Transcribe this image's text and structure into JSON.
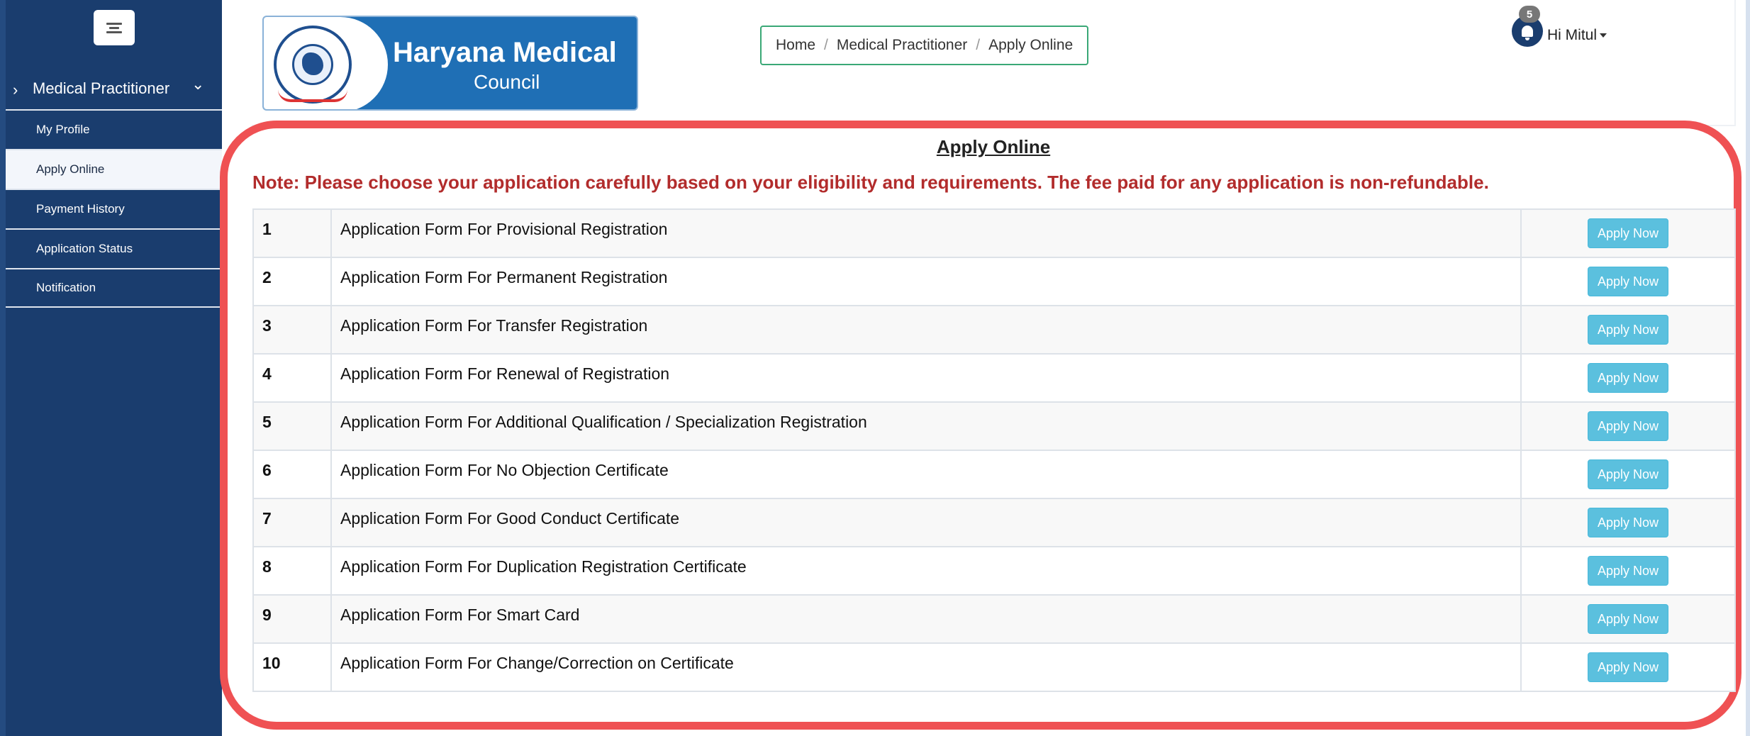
{
  "sidebar": {
    "section_label": "Medical Practitioner",
    "items": [
      {
        "label": "My Profile",
        "active": false
      },
      {
        "label": "Apply Online",
        "active": true
      },
      {
        "label": "Payment History",
        "active": false
      },
      {
        "label": "Application Status",
        "active": false
      },
      {
        "label": "Notification",
        "active": false
      }
    ]
  },
  "header": {
    "logo_title": "Haryana Medical",
    "logo_subtitle": "Council",
    "breadcrumb": [
      "Home",
      "Medical Practitioner",
      "Apply Online"
    ],
    "notification_count": "5",
    "greeting": "Hi Mitul"
  },
  "main": {
    "title": "Apply Online",
    "note": "Note: Please choose your application carefully based on your eligibility and requirements. The fee paid for any application is non-refundable.",
    "button_label": "Apply Now",
    "applications": [
      {
        "num": "1",
        "name": "Application Form For Provisional Registration"
      },
      {
        "num": "2",
        "name": "Application Form For Permanent Registration"
      },
      {
        "num": "3",
        "name": "Application Form For Transfer Registration"
      },
      {
        "num": "4",
        "name": "Application Form For Renewal of Registration"
      },
      {
        "num": "5",
        "name": "Application Form For Additional Qualification / Specialization Registration"
      },
      {
        "num": "6",
        "name": "Application Form For No Objection Certificate"
      },
      {
        "num": "7",
        "name": "Application Form For Good Conduct Certificate"
      },
      {
        "num": "8",
        "name": "Application Form For Duplication Registration Certificate"
      },
      {
        "num": "9",
        "name": "Application Form For Smart Card"
      },
      {
        "num": "10",
        "name": "Application Form For Change/Correction on Certificate"
      }
    ]
  },
  "colors": {
    "sidebar": "#1a3d6e",
    "note_red": "#b22c2c",
    "button": "#5bc0de",
    "highlight_frame": "#ef5153",
    "breadcrumb_border": "#3aa876"
  }
}
